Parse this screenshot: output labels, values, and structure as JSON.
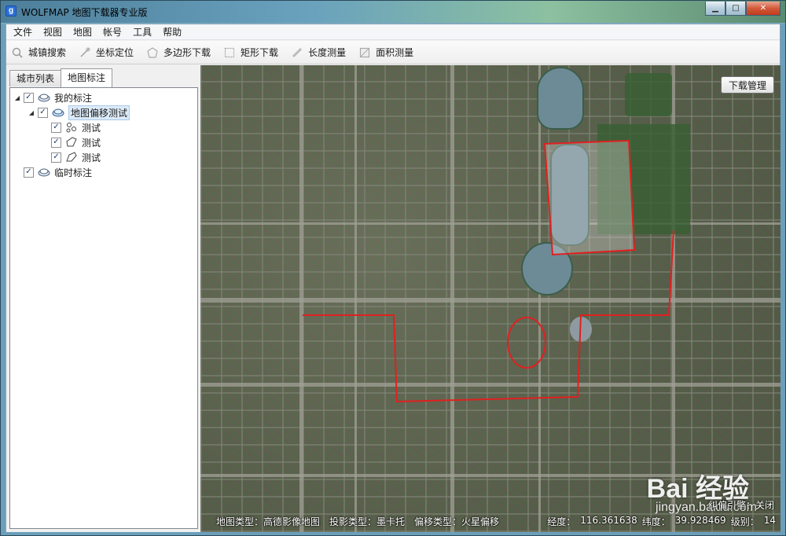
{
  "window": {
    "title": "WOLFMAP 地图下载器专业版",
    "icon_letter": "g"
  },
  "menu": [
    "文件",
    "视图",
    "地图",
    "帐号",
    "工具",
    "帮助"
  ],
  "toolbar": [
    {
      "label": "城镇搜索",
      "icon": "search-icon"
    },
    {
      "label": "坐标定位",
      "icon": "pin-icon"
    },
    {
      "label": "多边形下载",
      "icon": "polygon-icon"
    },
    {
      "label": "矩形下载",
      "icon": "rectangle-icon"
    },
    {
      "label": "长度测量",
      "icon": "ruler-icon"
    },
    {
      "label": "面积测量",
      "icon": "area-icon"
    }
  ],
  "tabs": [
    {
      "label": "城市列表",
      "active": false
    },
    {
      "label": "地图标注",
      "active": true
    }
  ],
  "tree": [
    {
      "label": "我的标注",
      "level": 0,
      "checked": true,
      "expanded": true,
      "icon": "layer-icon"
    },
    {
      "label": "地图偏移测试",
      "level": 1,
      "checked": true,
      "expanded": true,
      "icon": "layer-icon",
      "selected": true
    },
    {
      "label": "测试",
      "level": 2,
      "checked": true,
      "icon": "points-icon"
    },
    {
      "label": "测试",
      "level": 2,
      "checked": true,
      "icon": "polygon-icon"
    },
    {
      "label": "测试",
      "level": 2,
      "checked": true,
      "icon": "polygon-icon"
    },
    {
      "label": "临时标注",
      "level": 0,
      "checked": true,
      "icon": "layer-icon"
    }
  ],
  "map": {
    "download_manager": "下载管理",
    "status": {
      "map_type": "地图类型：高德影像地图",
      "projection": "投影类型：墨卡托",
      "offset": "偏移类型：火星偏移",
      "lon_label": "经度：",
      "lon": "116.361638",
      "lat_label": "纬度：",
      "lat": "39.928469",
      "level_label": "级别：",
      "level": "14"
    },
    "rectify": "纠偏引擎：关闭",
    "watermark": "Bai 经验",
    "watermark_url": "jingyan.baidu.com",
    "overlay_color": "#e02020"
  }
}
